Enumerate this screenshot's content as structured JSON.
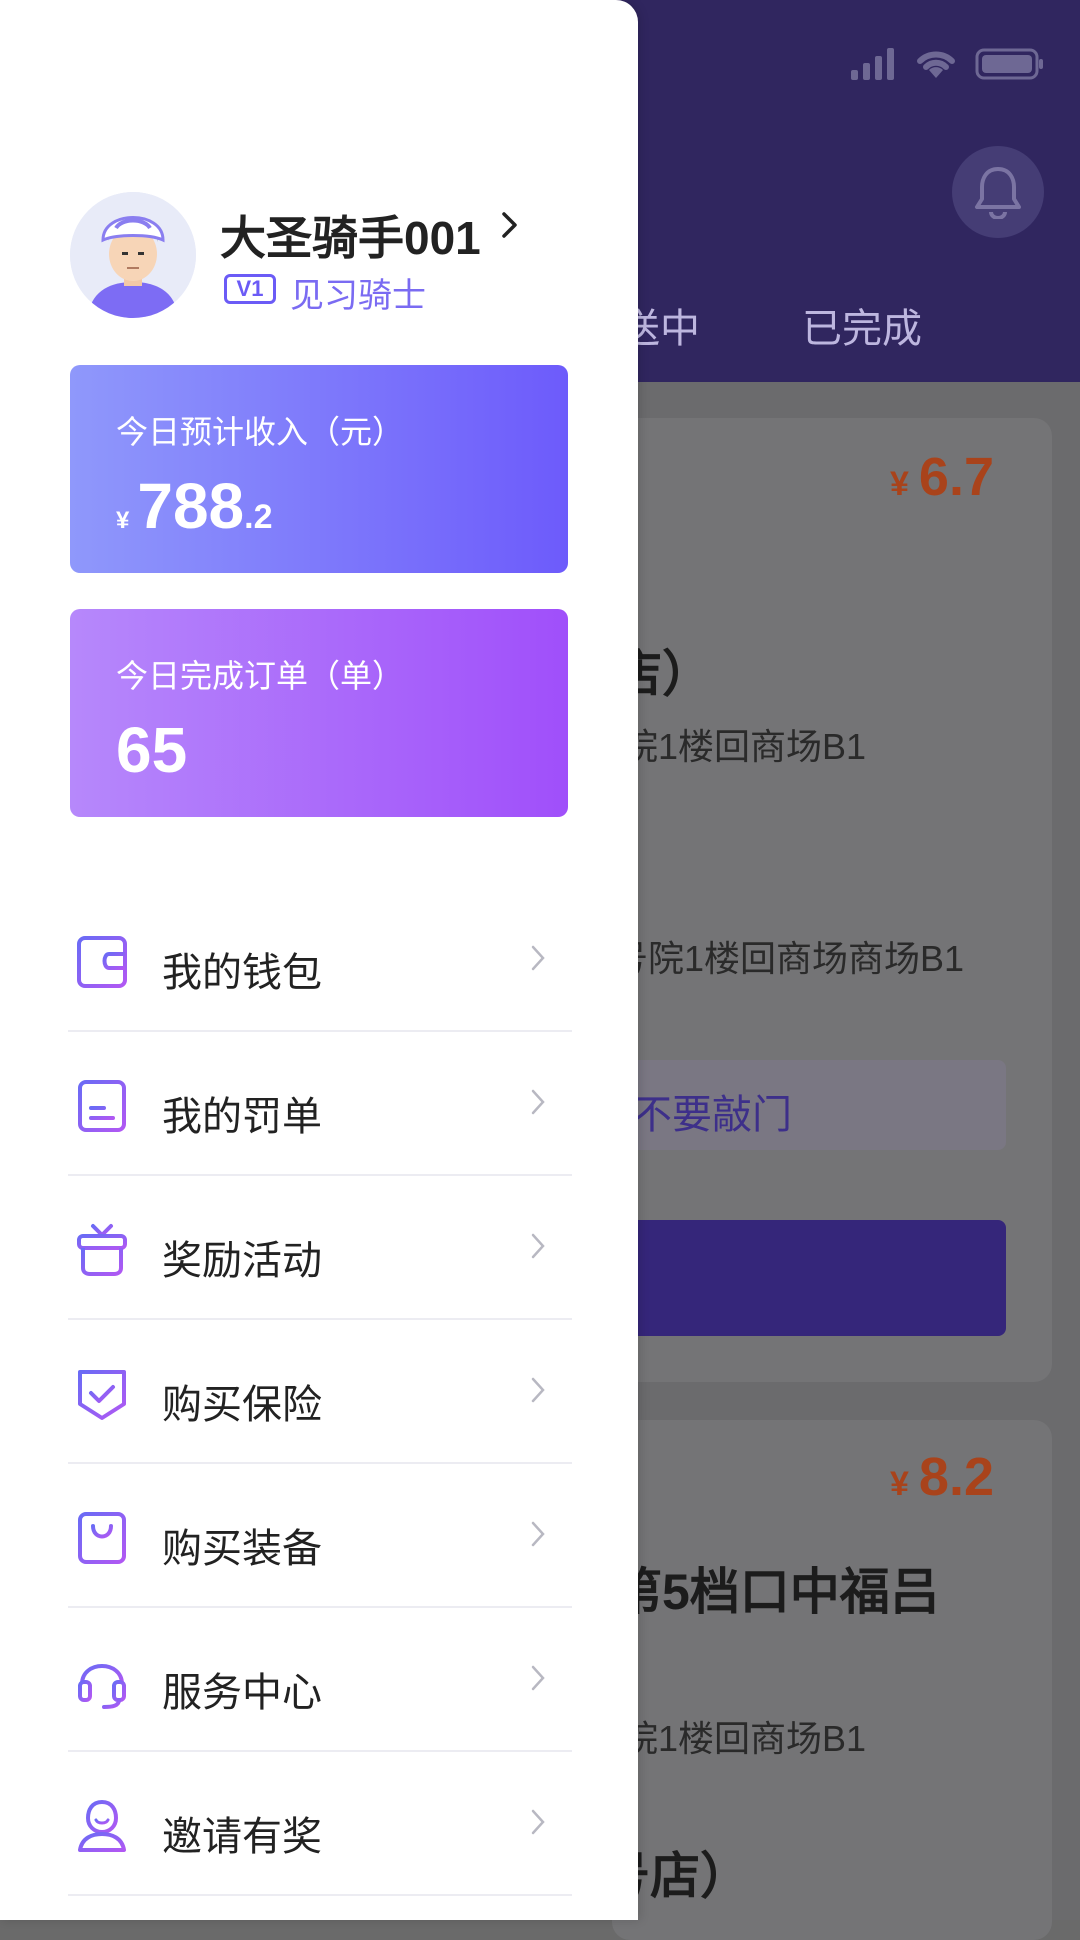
{
  "background": {
    "tabs": [
      "送中",
      "已完成"
    ],
    "orders": [
      {
        "currency": "¥",
        "price": "6.7",
        "title_fragment": "店）",
        "pickup_fragment": "院1楼回商场B1",
        "dropoff_fragment": "号院1楼回商场商场B1",
        "note_fragment": "不要敲门"
      },
      {
        "currency": "¥",
        "price": "8.2",
        "title_fragment": "第5档口中福吕",
        "pickup_fragment": "院1楼回商场B1",
        "subtitle_fragment": "号店）"
      }
    ]
  },
  "drawer": {
    "user": {
      "name": "大圣骑手001",
      "level_badge": "V1",
      "level_name": "见习骑士"
    },
    "income": {
      "label": "今日预计收入（元）",
      "currency": "¥",
      "integer": "788",
      "decimal": ".2"
    },
    "orders": {
      "label": "今日完成订单（单）",
      "value": "65"
    },
    "menu": [
      {
        "label": "我的钱包",
        "icon": "wallet-icon"
      },
      {
        "label": "我的罚单",
        "icon": "ticket-icon"
      },
      {
        "label": "奖励活动",
        "icon": "gift-icon"
      },
      {
        "label": "购买保险",
        "icon": "shield-check-icon"
      },
      {
        "label": "购买装备",
        "icon": "shopping-bag-icon"
      },
      {
        "label": "服务中心",
        "icon": "headset-icon"
      },
      {
        "label": "邀请有奖",
        "icon": "person-icon"
      }
    ]
  },
  "colors": {
    "accent": "#7b6bf6",
    "header_bg": "#30265f",
    "price": "#a9431b"
  }
}
